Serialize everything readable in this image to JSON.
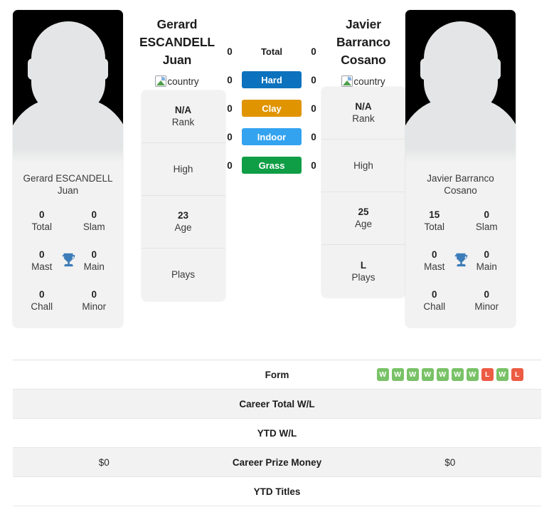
{
  "players": {
    "left": {
      "name": "Gerard ESCANDELL Juan",
      "name_lines": [
        "Gerard",
        "ESCANDELL",
        "Juan"
      ],
      "photo_caption": "Gerard ESCANDELL Juan",
      "country_alt": "country",
      "info": [
        {
          "value": "N/A",
          "label": "Rank"
        },
        {
          "value": "",
          "label": "High"
        },
        {
          "value": "23",
          "label": "Age"
        },
        {
          "value": "",
          "label": "Plays"
        }
      ],
      "titles": [
        {
          "value": "0",
          "label": "Total"
        },
        {
          "value": "0",
          "label": "Slam"
        },
        {
          "value": "0",
          "label": "Mast"
        },
        {
          "value": "0",
          "label": "Main"
        },
        {
          "value": "0",
          "label": "Chall"
        },
        {
          "value": "0",
          "label": "Minor"
        }
      ]
    },
    "right": {
      "name": "Javier Barranco Cosano",
      "name_lines": [
        "Javier",
        "Barranco",
        "Cosano"
      ],
      "photo_caption": "Javier Barranco Cosano",
      "country_alt": "country",
      "info": [
        {
          "value": "N/A",
          "label": "Rank"
        },
        {
          "value": "",
          "label": "High"
        },
        {
          "value": "25",
          "label": "Age"
        },
        {
          "value": "L",
          "label": "Plays"
        }
      ],
      "titles": [
        {
          "value": "15",
          "label": "Total"
        },
        {
          "value": "0",
          "label": "Slam"
        },
        {
          "value": "0",
          "label": "Mast"
        },
        {
          "value": "0",
          "label": "Main"
        },
        {
          "value": "0",
          "label": "Chall"
        },
        {
          "value": "0",
          "label": "Minor"
        }
      ]
    }
  },
  "surfaces": [
    {
      "label": "Total",
      "left": "0",
      "right": "0",
      "color": ""
    },
    {
      "label": "Hard",
      "left": "0",
      "right": "0",
      "color": "#0c72bd"
    },
    {
      "label": "Clay",
      "left": "0",
      "right": "0",
      "color": "#e09400"
    },
    {
      "label": "Indoor",
      "left": "0",
      "right": "0",
      "color": "#33a3f0"
    },
    {
      "label": "Grass",
      "left": "0",
      "right": "0",
      "color": "#0f9e46"
    }
  ],
  "stats": [
    {
      "label": "Form",
      "left": "",
      "right": "",
      "right_form": [
        "W",
        "W",
        "W",
        "W",
        "W",
        "W",
        "W",
        "L",
        "W",
        "L"
      ]
    },
    {
      "label": "Career Total W/L",
      "left": "",
      "right": ""
    },
    {
      "label": "YTD W/L",
      "left": "",
      "right": ""
    },
    {
      "label": "Career Prize Money",
      "left": "$0",
      "right": "$0"
    },
    {
      "label": "YTD Titles",
      "left": "",
      "right": ""
    }
  ],
  "colors": {
    "win": "#79c267",
    "loss": "#ec5b43",
    "trophy": "#3d7cb8",
    "row_alt": "#f2f2f2"
  },
  "icons": {
    "trophy": "trophy-icon",
    "broken_image": "broken-image-icon"
  }
}
